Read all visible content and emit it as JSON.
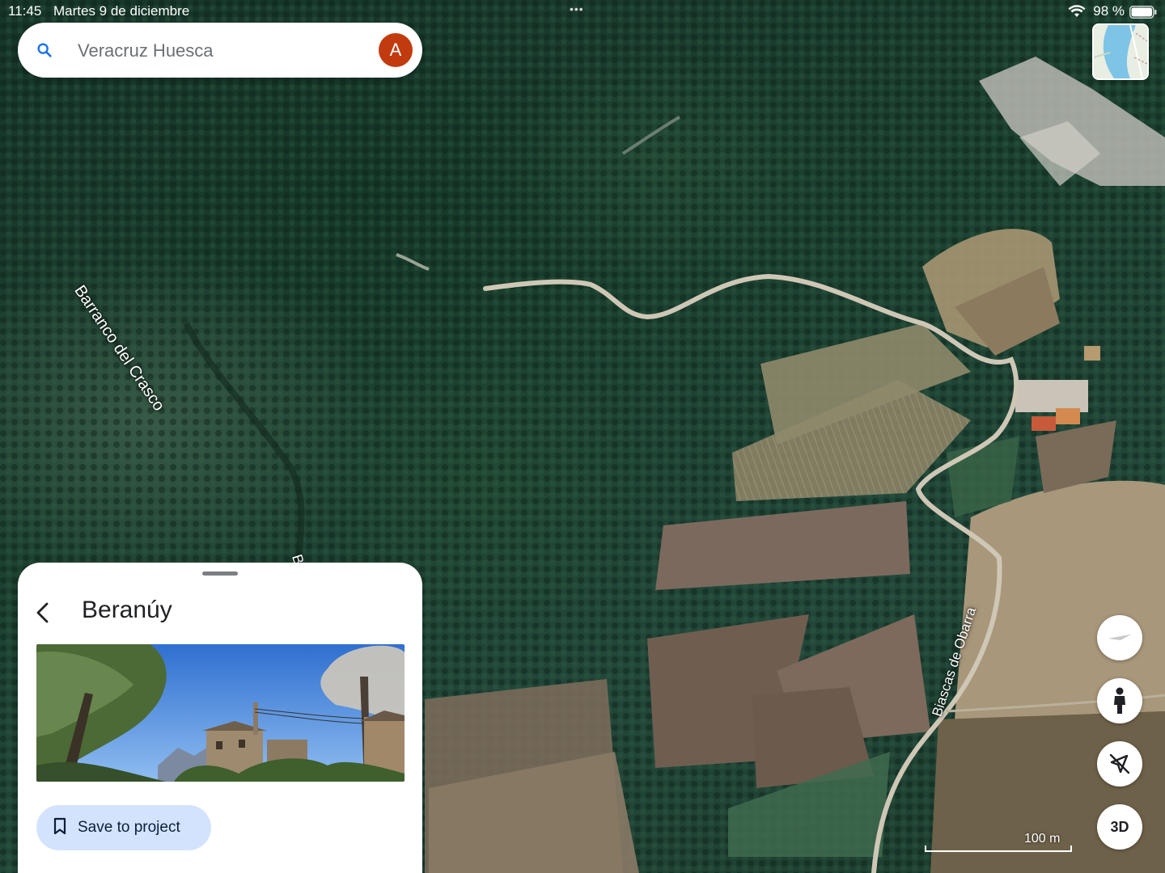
{
  "status_bar": {
    "time": "11:45",
    "date": "Martes 9 de diciembre",
    "battery": "98 %",
    "more_dots": "•••"
  },
  "search": {
    "query": "Veracruz Huesca",
    "avatar_letter": "A"
  },
  "map": {
    "labels": {
      "barranco": "Barranco del Crasco",
      "cut_label": "B",
      "road": "Biascas de Obarra"
    },
    "scale": "100 m"
  },
  "controls": {
    "threed_label": "3D"
  },
  "place": {
    "title": "Beranúy",
    "save_label": "Save to project"
  },
  "colors": {
    "avatar": "#c23b0e",
    "save_button_bg": "#d3e3fd",
    "compass_red": "#e8453c"
  }
}
